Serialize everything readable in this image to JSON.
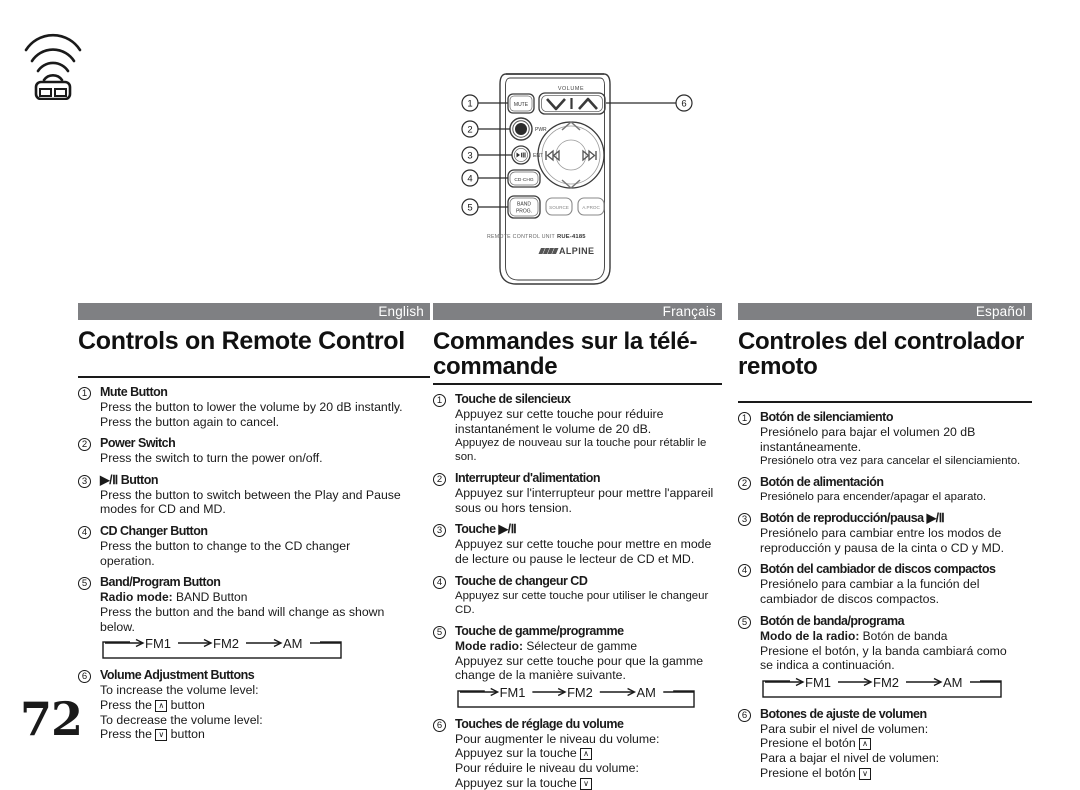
{
  "page": {
    "number": "72",
    "ir_icon_name": "ir-remote-signal-icon"
  },
  "figure": {
    "name": "remote-control-diagram",
    "volume_label": "VOLUME",
    "model_prefix": "REMOTE CONTROL UNIT",
    "model": "RUE-4185",
    "brand": "ALPINE",
    "buttons": {
      "mute": "MUTE",
      "power": "PWR",
      "play_pause": "ENT",
      "cd_chg": "CD·CHG",
      "band_line1": "BAND",
      "band_line2": "PROG.",
      "source": "SOURCE",
      "a_proc": "A.PROC"
    },
    "callouts": [
      "1",
      "2",
      "3",
      "4",
      "5",
      "6"
    ]
  },
  "columns": [
    {
      "lang": "English",
      "title": "Controls on Remote Control",
      "items": [
        {
          "num": "1",
          "head": "Mute Button",
          "lines": [
            "Press the button to lower the volume by 20 dB instantly.",
            "Press the button again to cancel."
          ]
        },
        {
          "num": "2",
          "head": "Power Switch",
          "lines": [
            "Press the switch to turn the power on/off."
          ]
        },
        {
          "num": "3",
          "head": "▶/Ⅱ Button",
          "lines": [
            "Press the button to switch between the Play and Pause",
            "modes for CD and MD."
          ]
        },
        {
          "num": "4",
          "head": "CD Changer Button",
          "lines": [
            "Press the button to change to the CD changer",
            "operation."
          ]
        },
        {
          "num": "5",
          "head": "Band/Program Button",
          "sub_bold": "Radio mode:",
          "sub_rest": " BAND Button",
          "lines": [
            "Press the button and the band will change as shown",
            "below."
          ],
          "diagram": {
            "a": "FM1",
            "b": "FM2",
            "c": "AM"
          }
        },
        {
          "num": "6",
          "head": "Volume Adjustment Buttons",
          "vol": [
            {
              "text": "To increase the volume level:"
            },
            {
              "pre": "Press the ",
              "key": "∧",
              "post": " button"
            },
            {
              "text": "To decrease the volume level:"
            },
            {
              "pre": "Press the ",
              "key": "∨",
              "post": " button"
            }
          ]
        }
      ]
    },
    {
      "lang": "Français",
      "title": "Commandes sur la télé-commande",
      "items": [
        {
          "num": "1",
          "head": "Touche de silencieux",
          "lines": [
            "Appuyez sur cette touche pour réduire",
            "instantanément le volume de 20 dB."
          ],
          "small_lines": [
            "Appuyez de nouveau sur la touche pour rétablir le son."
          ]
        },
        {
          "num": "2",
          "head": "Interrupteur d'alimentation",
          "lines": [
            "Appuyez sur l'interrupteur pour mettre l'appareil",
            "sous ou hors tension."
          ]
        },
        {
          "num": "3",
          "head": "Touche ▶/Ⅱ",
          "lines": [
            "Appuyez sur cette touche pour mettre en mode",
            "de lecture ou pause le lecteur de CD et MD."
          ]
        },
        {
          "num": "4",
          "head": "Touche de changeur CD",
          "small_lines": [
            "Appuyez sur cette touche pour utiliser le changeur CD."
          ]
        },
        {
          "num": "5",
          "head": "Touche de gamme/programme",
          "sub_bold": "Mode radio:",
          "sub_rest": " Sélecteur de gamme",
          "lines": [
            "Appuyez sur cette touche pour que la gamme",
            "change de la manière suivante."
          ],
          "diagram": {
            "a": "FM1",
            "b": "FM2",
            "c": "AM"
          }
        },
        {
          "num": "6",
          "head": "Touches de réglage du volume",
          "vol": [
            {
              "text": "Pour augmenter le niveau du volume:"
            },
            {
              "pre": "Appuyez sur la touche ",
              "key": "∧",
              "post": ""
            },
            {
              "text": "Pour réduire le niveau du volume:"
            },
            {
              "pre": "Appuyez sur la touche ",
              "key": "∨",
              "post": ""
            }
          ]
        }
      ]
    },
    {
      "lang": "Español",
      "title": "Controles del controlador remoto",
      "items": [
        {
          "num": "1",
          "head": "Botón de silenciamiento",
          "lines": [
            "Presiónelo para bajar el volumen 20 dB",
            "instantáneamente."
          ],
          "small_lines": [
            "Presiónelo otra vez para cancelar el silenciamiento."
          ]
        },
        {
          "num": "2",
          "head": "Botón de alimentación",
          "small_lines": [
            "Presiónelo para encender/apagar el aparato."
          ]
        },
        {
          "num": "3",
          "head": "Botón de reproducción/pausa ▶/Ⅱ",
          "lines": [
            "Presiónelo para cambiar entre los modos de",
            "reproducción y pausa de la cinta o CD y MD."
          ]
        },
        {
          "num": "4",
          "head": "Botón del cambiador de discos compactos",
          "lines": [
            "Presiónelo para cambiar a la función del",
            "cambiador de discos compactos."
          ]
        },
        {
          "num": "5",
          "head": "Botón de banda/programa",
          "sub_bold": "Modo de la radio:",
          "sub_rest": " Botón de banda",
          "lines": [
            "Presione el botón, y la banda cambiará como",
            "se indica a continuación."
          ],
          "diagram": {
            "a": "FM1",
            "b": "FM2",
            "c": "AM"
          }
        },
        {
          "num": "6",
          "head": "Botones de ajuste de volumen",
          "vol": [
            {
              "text": "Para subir el nivel de volumen:"
            },
            {
              "pre": "Presione el botón ",
              "key": "∧",
              "post": ""
            },
            {
              "text": "Para a bajar el nivel de volumen:"
            },
            {
              "pre": "Presione el botón ",
              "key": "∨",
              "post": ""
            }
          ]
        }
      ]
    }
  ],
  "colors": {
    "lang_bar": "#7f8083",
    "text": "#1a1a1a",
    "line": "#333333"
  }
}
